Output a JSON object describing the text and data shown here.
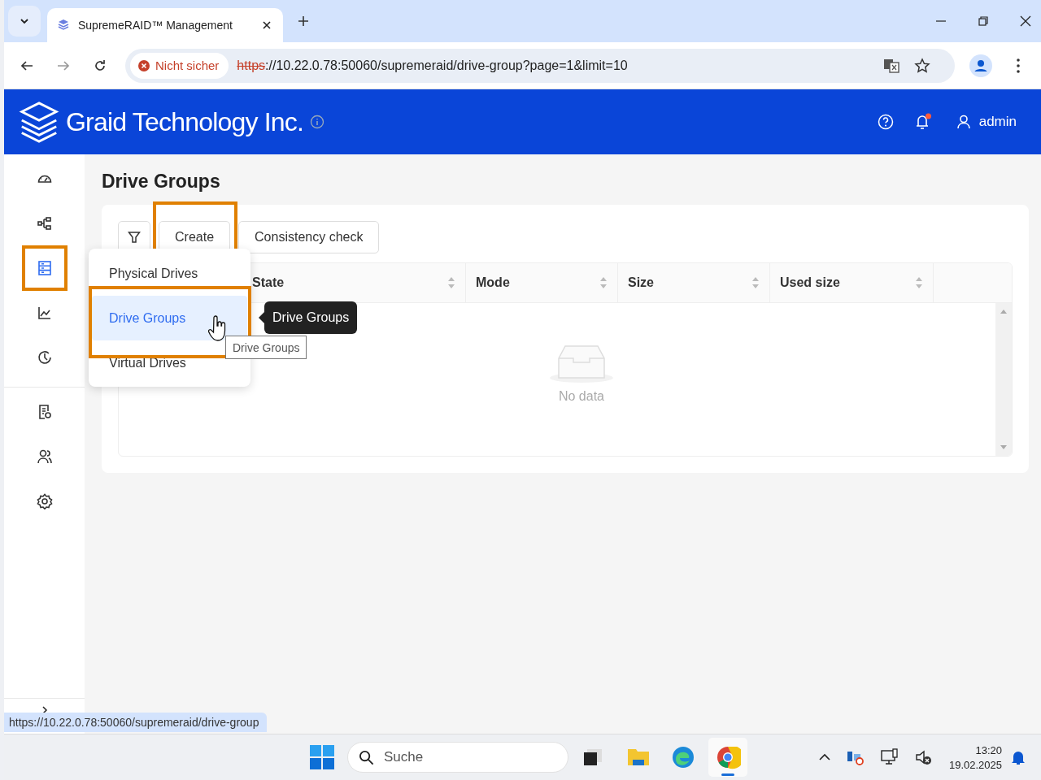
{
  "browser": {
    "tab": {
      "title": "SupremeRAID™ Management"
    },
    "security": "Nicht sicher",
    "url": {
      "scheme": "https",
      "rest": "://10.22.0.78:50060/supremeraid/drive-group?page=1&limit=10"
    }
  },
  "header": {
    "brand": "Graid Technology Inc.",
    "notifications_unread": true,
    "user": "admin"
  },
  "sidebar": {
    "groups": [
      [
        {
          "selected": false,
          "highlighted": false
        },
        {
          "selected": false,
          "highlighted": false
        },
        {
          "selected": true,
          "highlighted": true
        },
        {
          "selected": false,
          "highlighted": false
        },
        {
          "selected": false,
          "highlighted": false
        }
      ],
      [
        {
          "selected": false,
          "highlighted": false
        },
        {
          "selected": false,
          "highlighted": false
        },
        {
          "selected": false,
          "highlighted": false
        }
      ]
    ]
  },
  "page": {
    "title": "Drive Groups",
    "toolbar": [
      {
        "kind": "filter",
        "highlighted": false
      },
      {
        "kind": "text",
        "label": "Create",
        "highlighted": true
      },
      {
        "kind": "text",
        "label": "Consistency check",
        "highlighted": false
      }
    ],
    "table": {
      "columns": [
        {
          "label": "State"
        },
        {
          "label": "Mode"
        },
        {
          "label": "Size"
        },
        {
          "label": "Used size"
        }
      ],
      "empty_text": "No data"
    }
  },
  "menu": {
    "items": [
      {
        "label": "Physical Drives",
        "selected": false,
        "highlighted": false
      },
      {
        "label": "Drive Groups",
        "selected": true,
        "highlighted": true
      },
      {
        "label": "Virtual Drives",
        "selected": false,
        "highlighted": false
      }
    ]
  },
  "tooltip": "Drive Groups",
  "native_tooltip": "Drive Groups",
  "status_url": "https://10.22.0.78:50060/supremeraid/drive-group",
  "taskbar": {
    "search": {
      "placeholder": "Suche"
    },
    "apps": [
      {
        "selected": false
      },
      {
        "selected": false
      },
      {
        "selected": false
      },
      {
        "selected": true
      }
    ],
    "time": "13:20",
    "date": "19.02.2025"
  }
}
